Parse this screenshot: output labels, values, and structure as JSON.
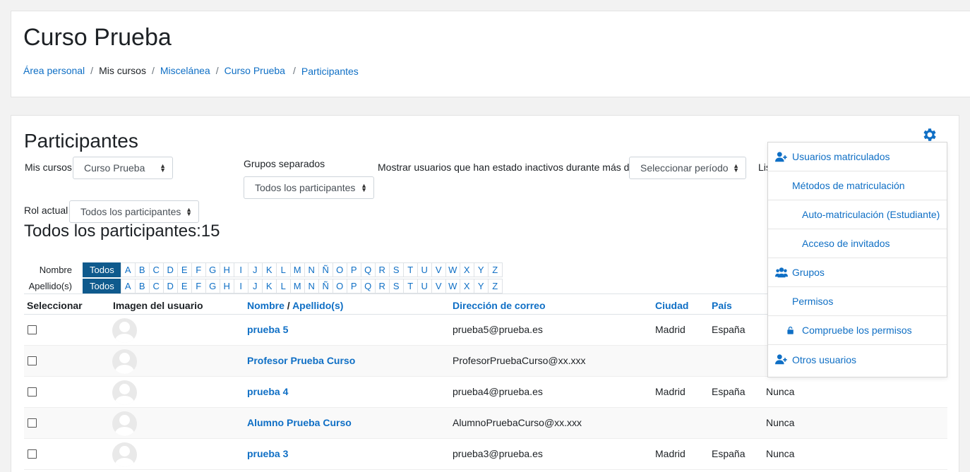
{
  "header": {
    "course_title": "Curso Prueba",
    "breadcrumb": [
      {
        "label": "Área personal",
        "link": true
      },
      {
        "label": "Mis cursos",
        "link": false
      },
      {
        "label": "Miscelánea",
        "link": true
      },
      {
        "label": "Curso Prueba",
        "link": true
      },
      {
        "label": "Participantes",
        "link": true
      }
    ]
  },
  "main": {
    "heading": "Participantes",
    "filters": {
      "my_courses_label": "Mis cursos",
      "my_courses_value": "Curso Prueba",
      "groups_label": "Grupos separados",
      "groups_value": "Todos los participantes",
      "inactive_label": "Mostrar usuarios que han estado inactivos durante más de",
      "inactive_value": "Seleccionar período",
      "cut_label": "Lis",
      "role_label": "Rol actual",
      "role_value": "Todos los participantes"
    },
    "total_label": "Todos los participantes:15",
    "initials": {
      "first_label": "Nombre",
      "last_label": "Apellido(s)",
      "all_label": "Todos",
      "letters": [
        "A",
        "B",
        "C",
        "D",
        "E",
        "F",
        "G",
        "H",
        "I",
        "J",
        "K",
        "L",
        "M",
        "N",
        "Ñ",
        "O",
        "P",
        "Q",
        "R",
        "S",
        "T",
        "U",
        "V",
        "W",
        "X",
        "Y",
        "Z"
      ]
    },
    "table": {
      "headers": {
        "select": "Seleccionar",
        "image": "Imagen del usuario",
        "first": "Nombre",
        "slash": "/",
        "last": "Apellido(s)",
        "email": "Dirección de correo",
        "city": "Ciudad",
        "country": "País"
      },
      "rows": [
        {
          "name": "prueba 5",
          "email": "prueba5@prueba.es",
          "city": "Madrid",
          "country": "España",
          "last_access": ""
        },
        {
          "name": "Profesor Prueba Curso",
          "email": "ProfesorPruebaCurso@xx.xxx",
          "city": "",
          "country": "",
          "last_access": ""
        },
        {
          "name": "prueba 4",
          "email": "prueba4@prueba.es",
          "city": "Madrid",
          "country": "España",
          "last_access": "Nunca"
        },
        {
          "name": "Alumno Prueba Curso",
          "email": "AlumnoPruebaCurso@xx.xxx",
          "city": "",
          "country": "",
          "last_access": "Nunca"
        },
        {
          "name": "prueba 3",
          "email": "prueba3@prueba.es",
          "city": "Madrid",
          "country": "España",
          "last_access": "Nunca"
        }
      ]
    }
  },
  "settings_menu": {
    "items": [
      {
        "label": "Usuarios matriculados",
        "icon": "user-plus-icon"
      },
      {
        "label": "Métodos de matriculación",
        "icon": ""
      },
      {
        "label": "Auto-matriculación (Estudiante)",
        "icon": ""
      },
      {
        "label": "Acceso de invitados",
        "icon": ""
      },
      {
        "label": "Grupos",
        "icon": "users-icon"
      },
      {
        "label": "Permisos",
        "icon": ""
      },
      {
        "label": "Compruebe los permisos",
        "icon": "unlock-icon"
      },
      {
        "label": "Otros usuarios",
        "icon": "user-plus-icon"
      }
    ]
  },
  "colors": {
    "link": "#0f6fc5",
    "active_initial": "#0f5a8d"
  }
}
